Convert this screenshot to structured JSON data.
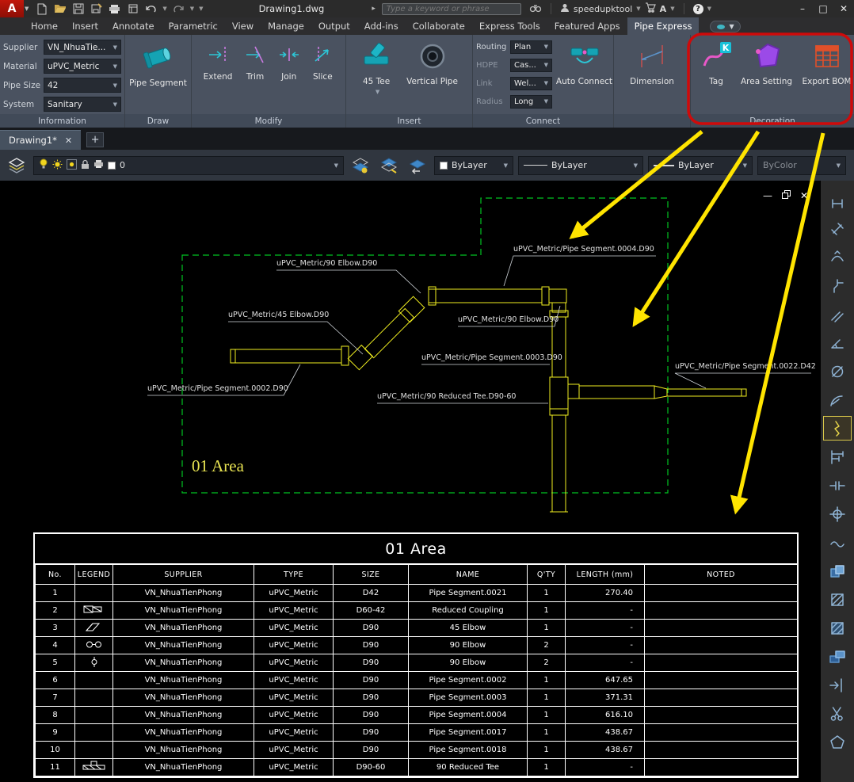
{
  "window": {
    "app_initial": "A",
    "title": "Drawing1.dwg",
    "search_placeholder": "Type a keyword or phrase",
    "account": "speedupktool",
    "exchange_initial": "A",
    "help_glyph": "?"
  },
  "ribbon_tabs": {
    "items": [
      "Home",
      "Insert",
      "Annotate",
      "Parametric",
      "View",
      "Manage",
      "Output",
      "Add-ins",
      "Collaborate",
      "Express Tools",
      "Featured Apps",
      "Pipe Express"
    ],
    "active": "Pipe Express"
  },
  "ribbon": {
    "information": {
      "label": "Information",
      "fields": [
        {
          "label": "Supplier",
          "value": "VN_NhuaTie..."
        },
        {
          "label": "Material",
          "value": "uPVC_Metric"
        },
        {
          "label": "Pipe Size",
          "value": "42"
        },
        {
          "label": "System",
          "value": "Sanitary"
        }
      ]
    },
    "draw": {
      "label": "Draw",
      "pipe_segment": "Pipe Segment"
    },
    "modify": {
      "label": "Modify",
      "buttons": [
        "Extend",
        "Trim",
        "Join",
        "Slice"
      ]
    },
    "insert": {
      "label": "Insert",
      "tee": "45 Tee",
      "vertical_pipe": "Vertical Pipe"
    },
    "connect": {
      "label": "Connect",
      "auto_connect": "Auto Connect",
      "fields": [
        {
          "label": "Routing",
          "value": "Plan"
        },
        {
          "label": "HDPE",
          "value": "Cas..."
        },
        {
          "label": "Link",
          "value": "Wel..."
        },
        {
          "label": "Radius",
          "value": "Long"
        }
      ]
    },
    "dimension": {
      "label": "",
      "button": "Dimension"
    },
    "decoration": {
      "label": "Decoration",
      "buttons": [
        "Tag",
        "Area Setting",
        "Export BOM"
      ]
    }
  },
  "doc_tabs": {
    "active": "Drawing1*",
    "new_tab": "+"
  },
  "layer_toolbar": {
    "layer": "0",
    "color": "ByLayer",
    "linetype": "ByLayer",
    "lineweight": "ByLayer",
    "plot_style": "ByColor"
  },
  "canvas": {
    "area_label": "01 Area",
    "labels": [
      "uPVC_Metric/90 Elbow.D90",
      "uPVC_Metric/Pipe Segment.0004.D90",
      "uPVC_Metric/45 Elbow.D90",
      "uPVC_Metric/90 Elbow.D90",
      "uPVC_Metric/Pipe Segment.0003.D90",
      "uPVC_Metric/Pipe Segment.0022.D42",
      "uPVC_Metric/Pipe Segment.0002.D90",
      "uPVC_Metric/90 Reduced Tee.D90-60"
    ],
    "colors": {
      "pipe": "#f0ee20",
      "boundary": "#00c322",
      "arrow": "#ffe400",
      "highlight": "#cf0a0a"
    }
  },
  "bom": {
    "title": "01 Area",
    "headers": [
      "No.",
      "LEGEND",
      "SUPPLIER",
      "TYPE",
      "SIZE",
      "NAME",
      "Q'TY",
      "LENGTH (mm)",
      "NOTED"
    ],
    "rows": [
      {
        "no": "1",
        "legend": "",
        "supplier": "VN_NhuaTienPhong",
        "type": "uPVC_Metric",
        "size": "D42",
        "name": "Pipe Segment.0021",
        "qty": "1",
        "length": "270.40",
        "noted": ""
      },
      {
        "no": "2",
        "legend": "coupling",
        "supplier": "VN_NhuaTienPhong",
        "type": "uPVC_Metric",
        "size": "D60-42",
        "name": "Reduced Coupling",
        "qty": "1",
        "length": "-",
        "noted": ""
      },
      {
        "no": "3",
        "legend": "elbow45",
        "supplier": "VN_NhuaTienPhong",
        "type": "uPVC_Metric",
        "size": "D90",
        "name": "45 Elbow",
        "qty": "1",
        "length": "-",
        "noted": ""
      },
      {
        "no": "4",
        "legend": "elbow90",
        "supplier": "VN_NhuaTienPhong",
        "type": "uPVC_Metric",
        "size": "D90",
        "name": "90 Elbow",
        "qty": "2",
        "length": "-",
        "noted": ""
      },
      {
        "no": "5",
        "legend": "elbow90b",
        "supplier": "VN_NhuaTienPhong",
        "type": "uPVC_Metric",
        "size": "D90",
        "name": "90 Elbow",
        "qty": "2",
        "length": "-",
        "noted": ""
      },
      {
        "no": "6",
        "legend": "",
        "supplier": "VN_NhuaTienPhong",
        "type": "uPVC_Metric",
        "size": "D90",
        "name": "Pipe Segment.0002",
        "qty": "1",
        "length": "647.65",
        "noted": ""
      },
      {
        "no": "7",
        "legend": "",
        "supplier": "VN_NhuaTienPhong",
        "type": "uPVC_Metric",
        "size": "D90",
        "name": "Pipe Segment.0003",
        "qty": "1",
        "length": "371.31",
        "noted": ""
      },
      {
        "no": "8",
        "legend": "",
        "supplier": "VN_NhuaTienPhong",
        "type": "uPVC_Metric",
        "size": "D90",
        "name": "Pipe Segment.0004",
        "qty": "1",
        "length": "616.10",
        "noted": ""
      },
      {
        "no": "9",
        "legend": "",
        "supplier": "VN_NhuaTienPhong",
        "type": "uPVC_Metric",
        "size": "D90",
        "name": "Pipe Segment.0017",
        "qty": "1",
        "length": "438.67",
        "noted": ""
      },
      {
        "no": "10",
        "legend": "",
        "supplier": "VN_NhuaTienPhong",
        "type": "uPVC_Metric",
        "size": "D90",
        "name": "Pipe Segment.0018",
        "qty": "1",
        "length": "438.67",
        "noted": ""
      },
      {
        "no": "11",
        "legend": "tee",
        "supplier": "VN_NhuaTienPhong",
        "type": "uPVC_Metric",
        "size": "D90-60",
        "name": "90 Reduced Tee",
        "qty": "1",
        "length": "-",
        "noted": ""
      }
    ]
  },
  "right_toolbar": {
    "icons": [
      {
        "name": "dim-linear-icon"
      },
      {
        "name": "dim-aligned-icon"
      },
      {
        "name": "dim-arc-length-icon"
      },
      {
        "name": "dim-ordinate-icon"
      },
      {
        "name": "dim-rotated-icon"
      },
      {
        "name": "dim-angular-icon"
      },
      {
        "name": "dim-diameter-icon"
      },
      {
        "name": "dim-radius-icon"
      },
      {
        "name": "dim-jogged-icon",
        "highlighted": true
      },
      {
        "name": "dim-baseline-icon"
      },
      {
        "name": "dim-continue-icon"
      },
      {
        "name": "center-mark-icon"
      },
      {
        "name": "dim-break-icon"
      },
      {
        "name": "layer-copy-icon"
      },
      {
        "name": "hatch-icon"
      },
      {
        "name": "hatch-edit-icon"
      },
      {
        "name": "layer-move-icon"
      },
      {
        "name": "export-layout-icon"
      },
      {
        "name": "cut-icon"
      },
      {
        "name": "polygon-icon"
      }
    ]
  }
}
